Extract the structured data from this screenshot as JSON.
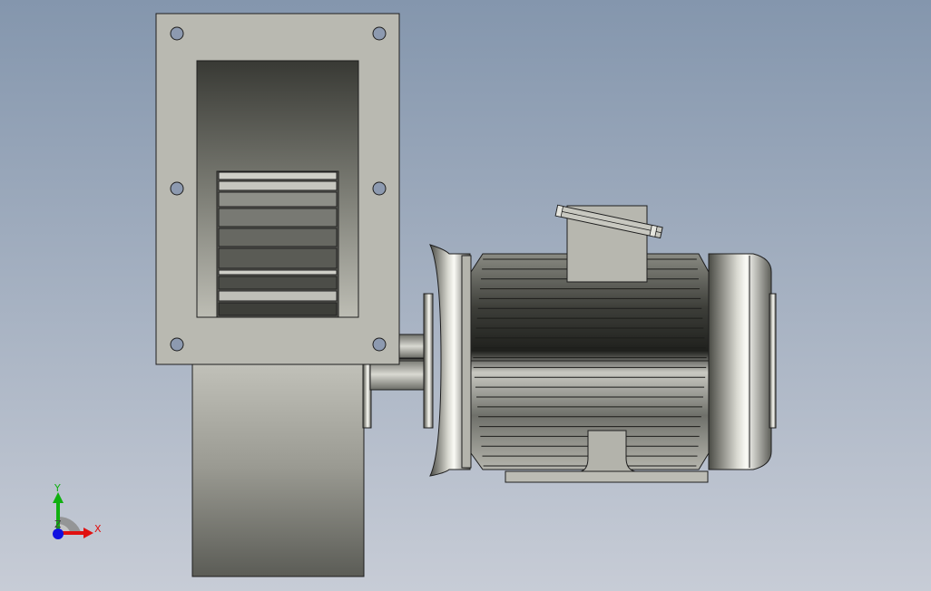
{
  "viewport": {
    "background_top": "#8496ad",
    "background_bottom": "#c7ccd6"
  },
  "model": {
    "parts": [
      "fan-housing",
      "inlet-flange",
      "inlet-louvers",
      "scroll-casing",
      "coupling-shaft",
      "motor-end-bell",
      "motor-frame",
      "terminal-box",
      "motor-rear-cap",
      "motor-base"
    ]
  },
  "triad": {
    "x_label": "X",
    "y_label": "Y",
    "z_label": "Z",
    "x_color": "#e01010",
    "y_color": "#10b010",
    "z_color": "#1010e0"
  }
}
